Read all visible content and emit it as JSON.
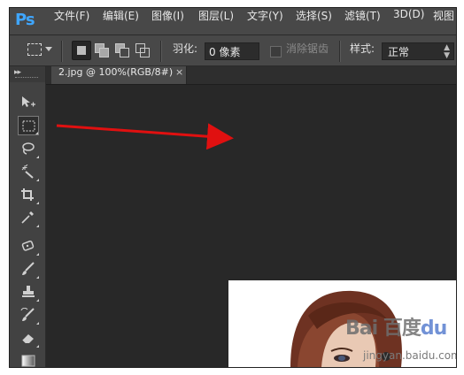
{
  "app": {
    "logo": "Ps"
  },
  "menu": {
    "items": [
      {
        "label": "文件(F)"
      },
      {
        "label": "编辑(E)"
      },
      {
        "label": "图像(I)"
      },
      {
        "label": "图层(L)"
      },
      {
        "label": "文字(Y)"
      },
      {
        "label": "选择(S)"
      },
      {
        "label": "滤镜(T)"
      },
      {
        "label": "3D(D)"
      },
      {
        "label": "视图"
      }
    ]
  },
  "options": {
    "active_tool_icon": "rect-marquee-icon",
    "selection_modes": [
      "new-selection-icon",
      "add-to-selection-icon",
      "subtract-from-selection-icon",
      "intersect-selection-icon"
    ],
    "feather_label": "羽化:",
    "feather_value": "0 像素",
    "antialias_label": "消除锯齿",
    "antialias_checked": false,
    "style_label": "样式:",
    "style_value": "正常"
  },
  "document": {
    "tab_label": "2.jpg @ 100%(RGB/8#)",
    "close_glyph": "×"
  },
  "toolbar": {
    "collapse_glyph": "▸▸",
    "tools": [
      {
        "name": "move-tool",
        "icon": "move-icon",
        "active": false
      },
      {
        "name": "rect-marquee-tool",
        "icon": "rect-marquee-icon",
        "active": true
      },
      {
        "name": "lasso-tool",
        "icon": "lasso-icon",
        "active": false
      },
      {
        "name": "magic-wand-tool",
        "icon": "magic-wand-icon",
        "active": false
      },
      {
        "name": "crop-tool",
        "icon": "crop-icon",
        "active": false
      },
      {
        "name": "eyedropper-tool",
        "icon": "eyedropper-icon",
        "active": false
      },
      {
        "name": "spot-healing-tool",
        "icon": "healing-icon",
        "active": false
      },
      {
        "name": "brush-tool",
        "icon": "brush-icon",
        "active": false
      },
      {
        "name": "clone-stamp-tool",
        "icon": "stamp-icon",
        "active": false
      },
      {
        "name": "history-brush-tool",
        "icon": "history-brush-icon",
        "active": false
      },
      {
        "name": "eraser-tool",
        "icon": "eraser-icon",
        "active": false
      },
      {
        "name": "gradient-tool",
        "icon": "gradient-icon",
        "active": false
      }
    ]
  },
  "canvas": {
    "watermark": "Bai  百度",
    "watermark_paw": "du",
    "watermark_sub": "jingyan.baidu.com"
  },
  "colors": {
    "accent_logo": "#3fa6ff",
    "annotation_arrow": "#e01010",
    "ui_dark": "#282828",
    "ui_panel": "#484848"
  }
}
